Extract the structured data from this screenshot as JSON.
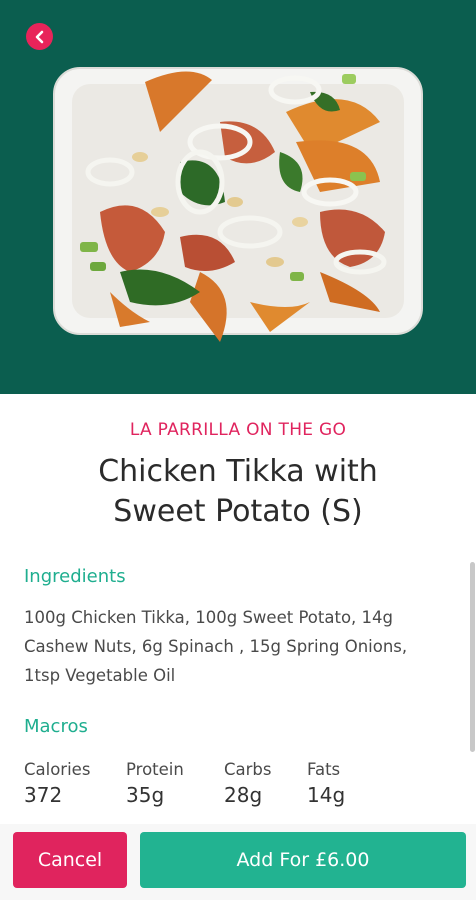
{
  "header": {
    "back_icon": "chevron-left-icon",
    "hero_background_color": "#0b5e4f",
    "accent_color": "#e8245a"
  },
  "product": {
    "restaurant": "LA PARRILLA ON THE GO",
    "title_line1": "Chicken Tikka with",
    "title_line2": "Sweet Potato (S)"
  },
  "ingredients": {
    "heading": "Ingredients",
    "line1": "100g Chicken Tikka, 100g Sweet Potato, 14g",
    "line2": "Cashew Nuts, 6g Spinach , 15g Spring Onions,",
    "line3": "1tsp Vegetable Oil"
  },
  "macros": {
    "heading": "Macros",
    "items": [
      {
        "label": "Calories",
        "value": "372"
      },
      {
        "label": "Protein",
        "value": "35g"
      },
      {
        "label": "Carbs",
        "value": "28g"
      },
      {
        "label": "Fats",
        "value": "14g"
      }
    ]
  },
  "actions": {
    "cancel_label": "Cancel",
    "add_label": "Add For £6.00",
    "cancel_color": "#e0245e",
    "add_color": "#22b391"
  }
}
